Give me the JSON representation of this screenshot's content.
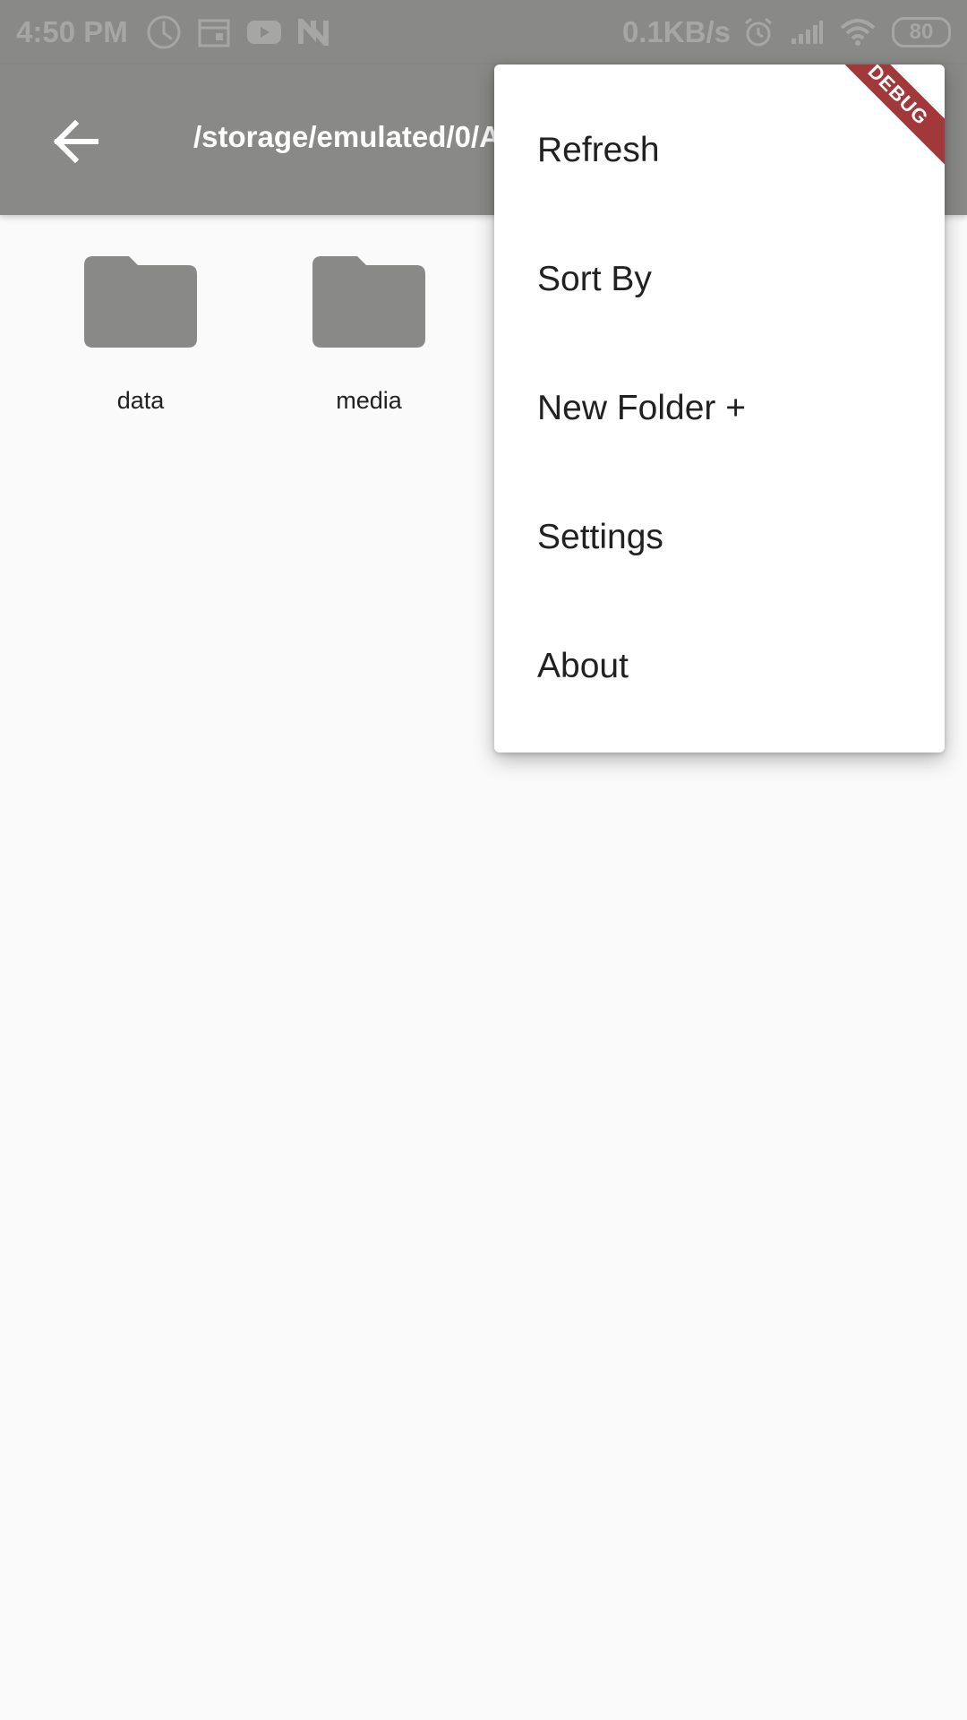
{
  "status_bar": {
    "time": "4:50 PM",
    "speed": "0.1KB/s",
    "battery": "80",
    "icons": [
      "clock-icon",
      "calendar-icon",
      "youtube-icon",
      "n-app-icon",
      "alarm-icon",
      "signal-icon",
      "wifi-icon",
      "battery-icon"
    ]
  },
  "app_bar": {
    "path": "/storage/emulated/0/Android"
  },
  "folders": [
    {
      "name": "data",
      "icon": "folder-icon"
    },
    {
      "name": "media",
      "icon": "folder-icon"
    }
  ],
  "menu": {
    "items": [
      {
        "label": "Refresh"
      },
      {
        "label": "Sort By"
      },
      {
        "label": "New Folder +"
      },
      {
        "label": "Settings"
      },
      {
        "label": "About"
      }
    ]
  },
  "debug_banner": {
    "label": "DEBUG"
  },
  "colors": {
    "app_bar": "#898a87",
    "background": "#fafafa",
    "folder": "#898a87",
    "banner": "#a3383a"
  }
}
